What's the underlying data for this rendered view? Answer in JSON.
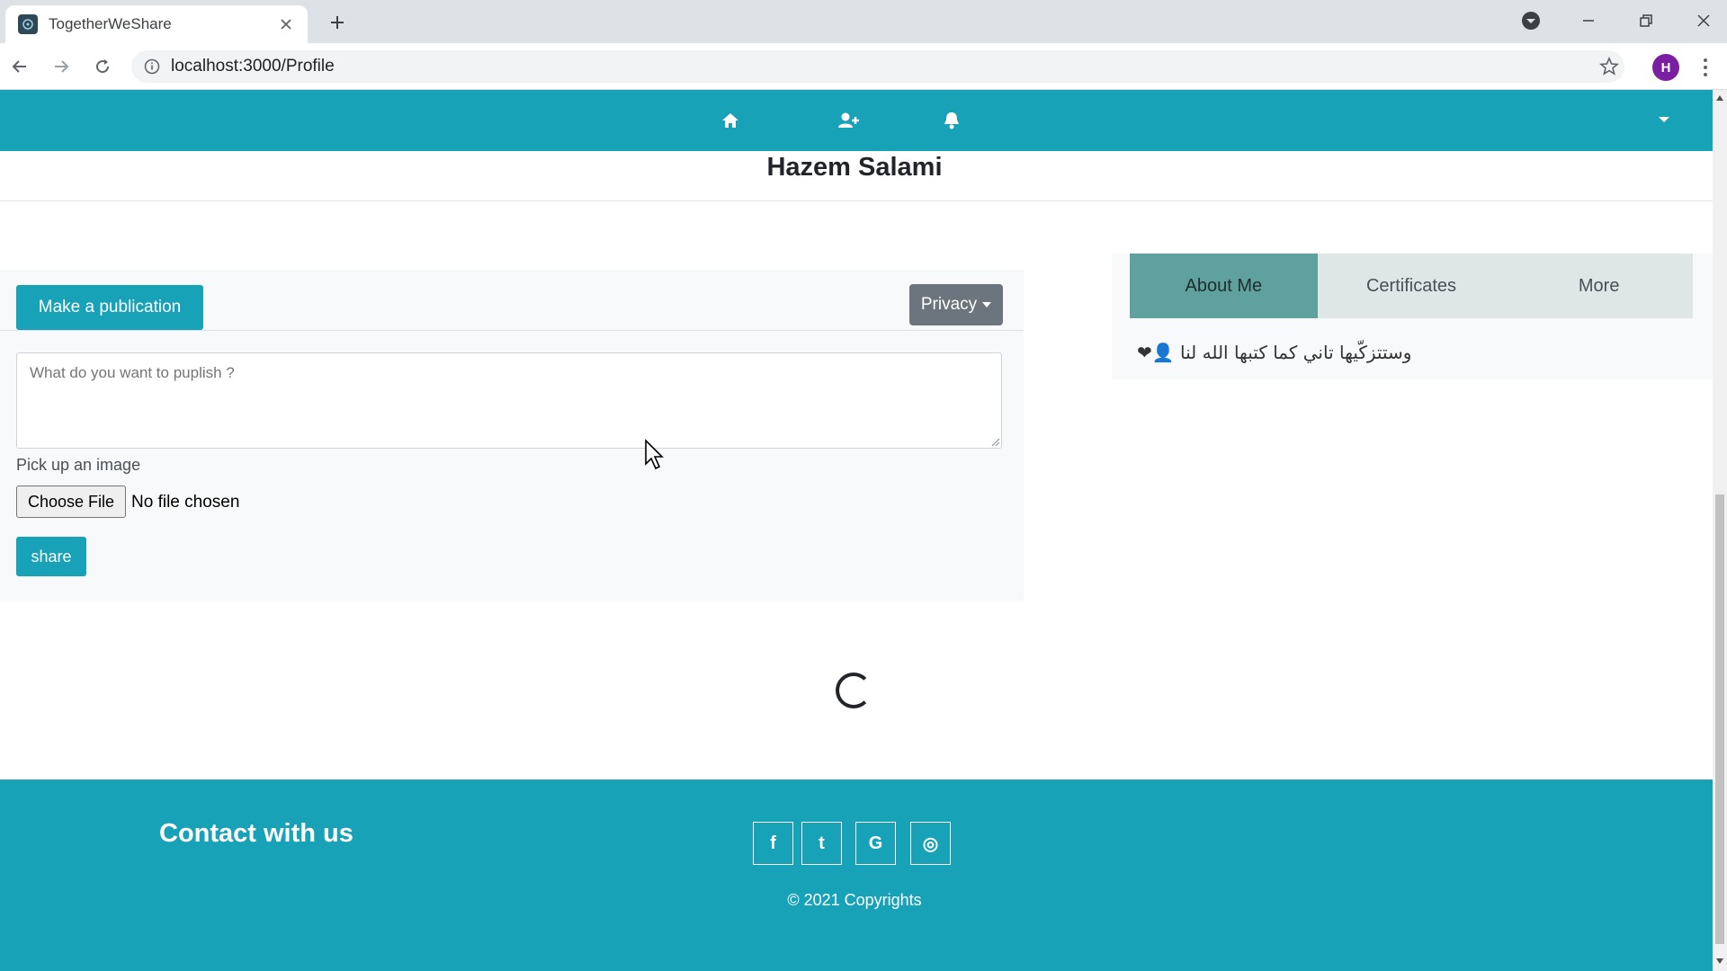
{
  "browser": {
    "tab_title": "TogetherWeShare",
    "url": "localhost:3000/Profile",
    "profile_initial": "H"
  },
  "navbar": {
    "icons": [
      "home-icon",
      "user-plus-icon",
      "bell-icon"
    ],
    "accent_color": "#17a2b8"
  },
  "profile": {
    "name": "Hazem Salami"
  },
  "publication": {
    "make_button": "Make a publication",
    "privacy_button": "Privacy",
    "textarea_placeholder": "What do you want to puplish ?",
    "pick_label": "Pick up an image",
    "file_button": "Choose File",
    "file_status": "No file chosen",
    "share_button": "share"
  },
  "about": {
    "tabs": [
      {
        "label": "About Me",
        "active": true
      },
      {
        "label": "Certificates",
        "active": false
      },
      {
        "label": "More",
        "active": false
      }
    ],
    "bio": "وستتزكّيها تاني كما كتبها الله لنا 👤❤"
  },
  "footer": {
    "title": "Contact with us",
    "social": [
      {
        "name": "facebook-icon",
        "glyph": "f"
      },
      {
        "name": "twitter-icon",
        "glyph": "t"
      },
      {
        "name": "google-icon",
        "glyph": "G"
      },
      {
        "name": "instagram-icon",
        "glyph": "◎"
      }
    ],
    "copyright": "© 2021 Copyrights"
  }
}
